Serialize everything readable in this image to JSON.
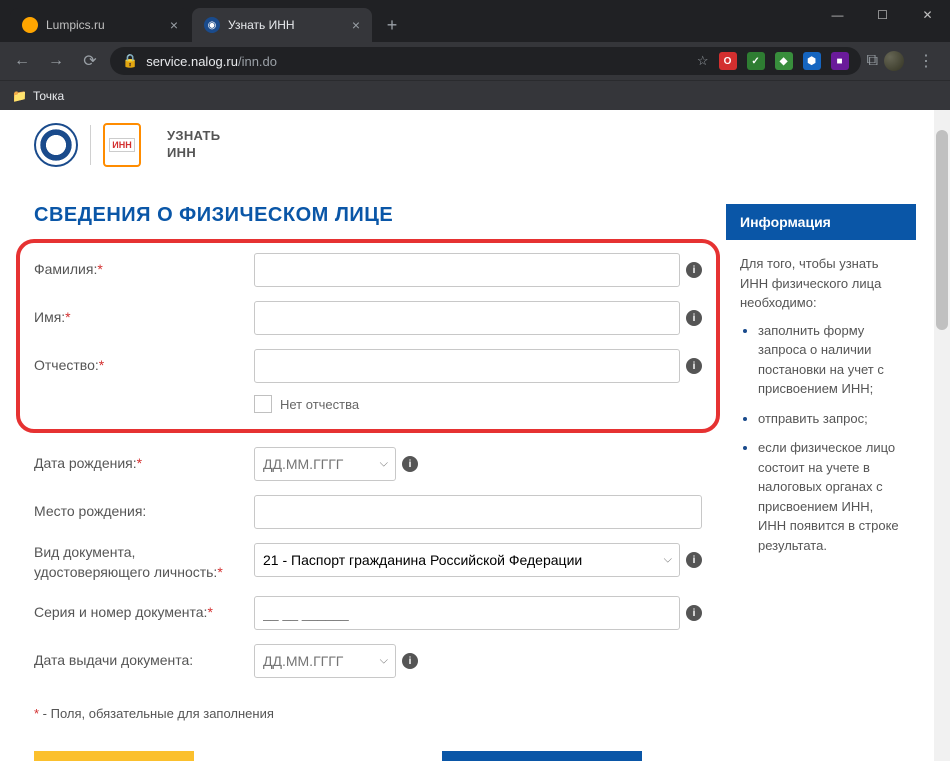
{
  "window": {
    "minimize": "—",
    "maximize": "☐",
    "close": "✕"
  },
  "tabs": [
    {
      "title": "Lumpics.ru",
      "active": false
    },
    {
      "title": "Узнать ИНН",
      "active": true
    }
  ],
  "tab_add": "+",
  "nav": {
    "back": "←",
    "forward": "→",
    "reload": "⟳"
  },
  "address": {
    "lock": "🔒",
    "host": "service.nalog.ru",
    "path": "/inn.do",
    "star": "☆"
  },
  "extensions": {
    "o_badge": "O",
    "check": "✓",
    "adguard": "◆",
    "cube": "⬢",
    "purple": "■",
    "readlist": "⧉"
  },
  "bookmarks": {
    "folder_icon": "📁",
    "item1": "Точка"
  },
  "header": {
    "logo2_text": "ИНН",
    "title_line1": "УЗНАТЬ",
    "title_line2": "ИНН"
  },
  "section_title": "СВЕДЕНИЯ О ФИЗИЧЕСКОМ ЛИЦЕ",
  "labels": {
    "surname": "Фамилия:",
    "name": "Имя:",
    "patronymic": "Отчество:",
    "no_patronymic": "Нет отчества",
    "birthdate": "Дата рождения:",
    "birthplace": "Место рождения:",
    "doctype": "Вид документа, удостоверяющего личность:",
    "docnum": "Серия и номер документа:",
    "docdate": "Дата выдачи документа:"
  },
  "values": {
    "surname": "",
    "name": "",
    "patronymic": "",
    "birthdate_placeholder": "ДД.ММ.ГГГГ",
    "birthplace": "",
    "doctype_selected": "21 - Паспорт гражданина Российской Федерации",
    "docnum_placeholder": "__ __ ______",
    "docdate_placeholder": "ДД.ММ.ГГГГ"
  },
  "caret": "⌵",
  "info_icon": "i",
  "required_note": "* - Поля, обязательные для заполнения",
  "sidebar": {
    "title": "Информация",
    "intro": "Для того, чтобы узнать ИНН физического лица необходимо:",
    "items": [
      "заполнить форму запроса о наличии постановки на учет с присвоением ИНН;",
      "отправить запрос;",
      "если физическое лицо состоит на учете в налоговых органах с присвоением ИНН, ИНН появится в строке результата."
    ]
  }
}
